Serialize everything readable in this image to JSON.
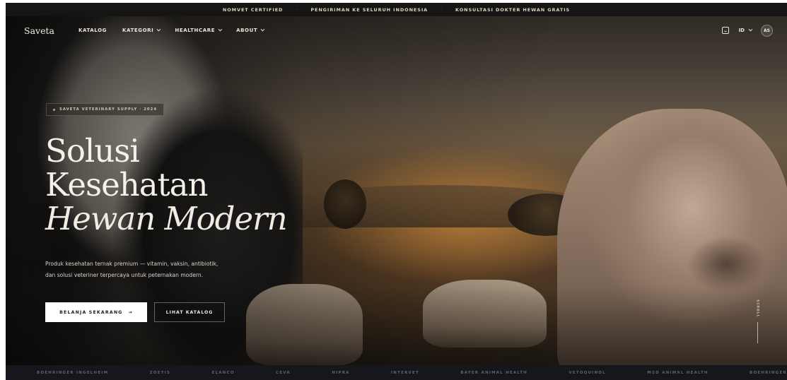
{
  "announcement": {
    "items": [
      "NOMVET CERTIFIED",
      "PENGIRIMAN KE SELURUH INDONESIA",
      "KONSULTASI DOKTER HEWAN GRATIS"
    ],
    "separator": "·"
  },
  "nav": {
    "brand": "Saveta",
    "links": [
      {
        "label": "KATALOG",
        "dropdown": false
      },
      {
        "label": "KATEGORI",
        "dropdown": true
      },
      {
        "label": "HEALTHCARE",
        "dropdown": true
      },
      {
        "label": "ABOUT",
        "dropdown": true
      }
    ],
    "cart_icon": "shopping-bag-icon",
    "language": "ID",
    "avatar_initials": "AS"
  },
  "hero": {
    "badge": "SAVETA VETERINARY SUPPLY · 2024",
    "title_line1": "Solusi",
    "title_line2": "Kesehatan",
    "title_line3": "Hewan Modern",
    "description_line1": "Produk kesehatan ternak premium — vitamin, vaksin, antibiotik,",
    "description_line2": "dan solusi veteriner terpercaya untuk peternakan modern.",
    "primary_button": "BELANJA SEKARANG",
    "primary_button_icon": "→",
    "secondary_button": "LIHAT KATALOG",
    "scroll_label": "SCROLL"
  },
  "brands": [
    "BOEHRINGER INGELHEIM",
    "ZOETIS",
    "ELANCO",
    "CEVA",
    "HIPRA",
    "INTERVET",
    "BAYER ANIMAL HEALTH",
    "VETOQUINOL",
    "MSD ANIMAL HEALTH",
    "BOEHRINGER"
  ],
  "colors": {
    "announce_bg": "#161513",
    "brands_bg": "#15171c",
    "primary_button_bg": "#ffffff",
    "text_light": "#f5f0e8"
  }
}
